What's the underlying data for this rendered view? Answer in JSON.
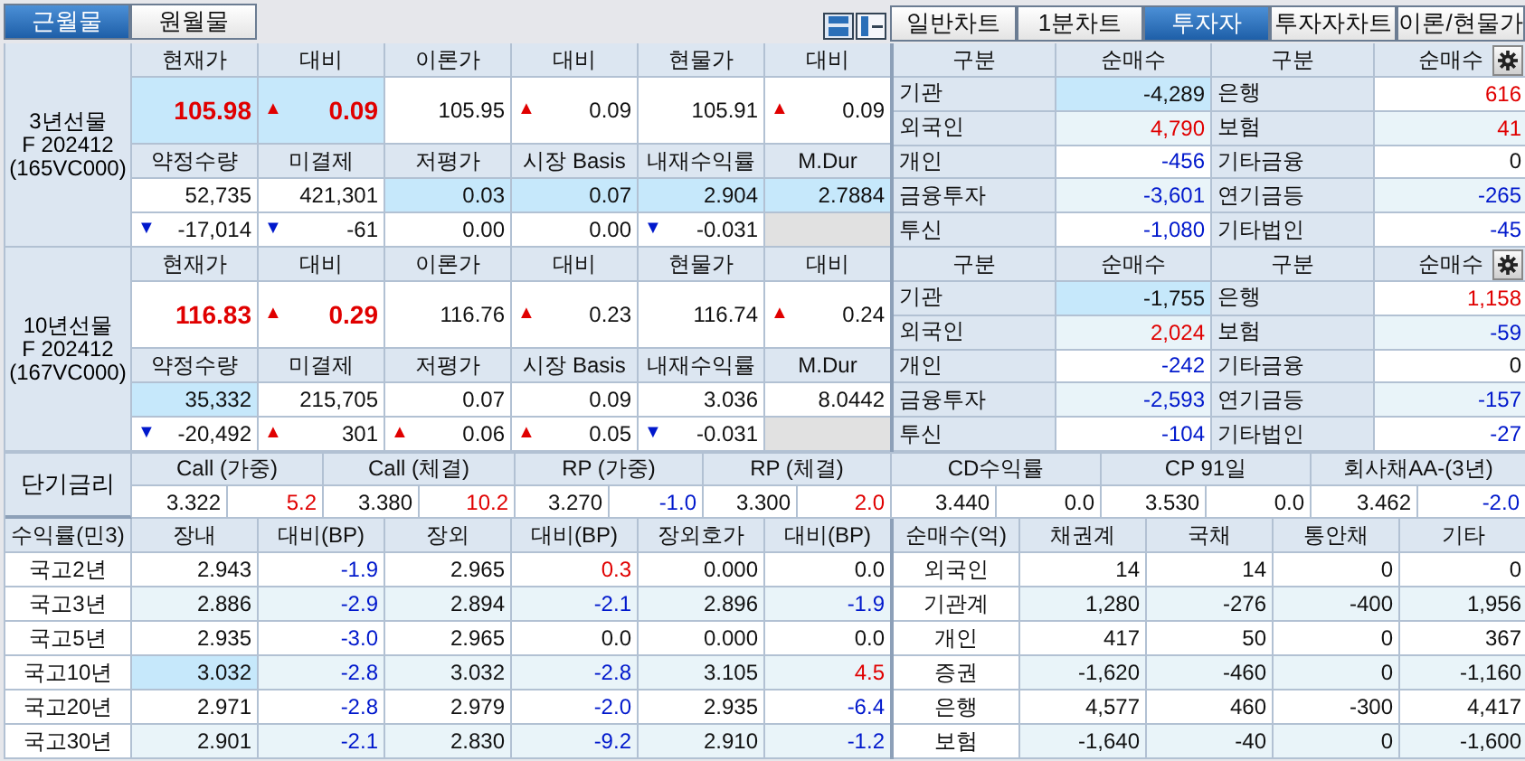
{
  "contract_tabs": [
    {
      "label": "근월물",
      "selected": true
    },
    {
      "label": "원월물",
      "selected": false
    }
  ],
  "view_tabs": [
    {
      "label": "일반차트",
      "selected": false
    },
    {
      "label": "1분차트",
      "selected": false
    },
    {
      "label": "투자자",
      "selected": true
    },
    {
      "label": "투자자차트",
      "selected": false
    },
    {
      "label": "이론/현물가",
      "selected": false
    }
  ],
  "futures": [
    {
      "label": [
        "3년선물",
        "F 202412",
        "(165VC000)"
      ],
      "header1": [
        "현재가",
        "대비",
        "이론가",
        "대비",
        "현물가",
        "대비"
      ],
      "row1": [
        {
          "text": "105.98",
          "color": "#e00000",
          "highlighted": true
        },
        {
          "text": "0.09",
          "arrow": {
            "symbol": "▲",
            "color": "#e00000"
          },
          "color": "#e00000",
          "highlighted": true
        },
        {
          "text": "105.95"
        },
        {
          "text": "0.09",
          "arrow": {
            "symbol": "▲",
            "color": "#e00000"
          }
        },
        {
          "text": "105.91"
        },
        {
          "text": "0.09",
          "arrow": {
            "symbol": "▲",
            "color": "#e00000"
          }
        }
      ],
      "header2": [
        "약정수량",
        "미결제",
        "저평가",
        "시장 Basis",
        "내재수익률",
        "M.Dur"
      ],
      "row2": [
        {
          "text": "52,735"
        },
        {
          "text": "421,301"
        },
        {
          "text": "0.03",
          "highlighted": true
        },
        {
          "text": "0.07",
          "highlighted": true
        },
        {
          "text": "2.904",
          "highlighted": true
        },
        {
          "text": "2.7884",
          "highlighted": true
        }
      ],
      "row3": [
        {
          "text": "-17,014",
          "arrow": {
            "symbol": "▼",
            "color": "#0018cc"
          }
        },
        {
          "text": "-61",
          "arrow": {
            "symbol": "▼",
            "color": "#0018cc"
          }
        },
        {
          "text": "0.00"
        },
        {
          "text": "0.00"
        },
        {
          "text": "-0.031",
          "arrow": {
            "symbol": "▼",
            "color": "#0018cc"
          }
        }
      ],
      "investors": {
        "header": [
          "구분",
          "순매수",
          "구분",
          "순매수"
        ],
        "rows": [
          {
            "left": "기관",
            "left_value": {
              "text": "-4,289",
              "highlighted": true
            },
            "right": "은행",
            "right_value": {
              "text": "616",
              "color": "#e00000"
            }
          },
          {
            "left": "외국인",
            "left_value": {
              "text": "4,790",
              "color": "#e00000"
            },
            "right": "보험",
            "right_value": {
              "text": "41",
              "color": "#e00000"
            }
          },
          {
            "left": "개인",
            "left_value": {
              "text": "-456",
              "color": "#0018cc"
            },
            "right": "기타금융",
            "right_value": {
              "text": "0"
            }
          },
          {
            "left": "금융투자",
            "left_value": {
              "text": "-3,601",
              "color": "#0018cc"
            },
            "right": "연기금등",
            "right_value": {
              "text": "-265",
              "color": "#0018cc"
            }
          },
          {
            "left": "투신",
            "left_value": {
              "text": "-1,080",
              "color": "#0018cc"
            },
            "right": "기타법인",
            "right_value": {
              "text": "-45",
              "color": "#0018cc"
            }
          }
        ]
      }
    },
    {
      "label": [
        "10년선물",
        "F 202412",
        "(167VC000)"
      ],
      "header1": [
        "현재가",
        "대비",
        "이론가",
        "대비",
        "현물가",
        "대비"
      ],
      "row1": [
        {
          "text": "116.83",
          "color": "#e00000"
        },
        {
          "text": "0.29",
          "arrow": {
            "symbol": "▲",
            "color": "#e00000"
          },
          "color": "#e00000"
        },
        {
          "text": "116.76"
        },
        {
          "text": "0.23",
          "arrow": {
            "symbol": "▲",
            "color": "#e00000"
          }
        },
        {
          "text": "116.74"
        },
        {
          "text": "0.24",
          "arrow": {
            "symbol": "▲",
            "color": "#e00000"
          }
        }
      ],
      "header2": [
        "약정수량",
        "미결제",
        "저평가",
        "시장 Basis",
        "내재수익률",
        "M.Dur"
      ],
      "row2": [
        {
          "text": "35,332",
          "highlighted": true
        },
        {
          "text": "215,705"
        },
        {
          "text": "0.07"
        },
        {
          "text": "0.09"
        },
        {
          "text": "3.036"
        },
        {
          "text": "8.0442"
        }
      ],
      "row3": [
        {
          "text": "-20,492",
          "arrow": {
            "symbol": "▼",
            "color": "#0018cc"
          }
        },
        {
          "text": "301",
          "arrow": {
            "symbol": "▲",
            "color": "#e00000"
          }
        },
        {
          "text": "0.06",
          "arrow": {
            "symbol": "▲",
            "color": "#e00000"
          }
        },
        {
          "text": "0.05",
          "arrow": {
            "symbol": "▲",
            "color": "#e00000"
          }
        },
        {
          "text": "-0.031",
          "arrow": {
            "symbol": "▼",
            "color": "#0018cc"
          }
        }
      ],
      "investors": {
        "header": [
          "구분",
          "순매수",
          "구분",
          "순매수"
        ],
        "rows": [
          {
            "left": "기관",
            "left_value": {
              "text": "-1,755",
              "highlighted": true
            },
            "right": "은행",
            "right_value": {
              "text": "1,158",
              "color": "#e00000"
            }
          },
          {
            "left": "외국인",
            "left_value": {
              "text": "2,024",
              "color": "#e00000"
            },
            "right": "보험",
            "right_value": {
              "text": "-59",
              "color": "#0018cc"
            }
          },
          {
            "left": "개인",
            "left_value": {
              "text": "-242",
              "color": "#0018cc"
            },
            "right": "기타금융",
            "right_value": {
              "text": "0"
            }
          },
          {
            "left": "금융투자",
            "left_value": {
              "text": "-2,593",
              "color": "#0018cc"
            },
            "right": "연기금등",
            "right_value": {
              "text": "-157",
              "color": "#0018cc"
            }
          },
          {
            "left": "투신",
            "left_value": {
              "text": "-104",
              "color": "#0018cc"
            },
            "right": "기타법인",
            "right_value": {
              "text": "-27",
              "color": "#0018cc"
            }
          }
        ]
      }
    }
  ],
  "short_rates": {
    "label": "단기금리",
    "groups": [
      {
        "title": "Call (가중)",
        "rate": "3.322",
        "change": {
          "text": "5.2",
          "color": "#e00000"
        }
      },
      {
        "title": "Call (체결)",
        "rate": "3.380",
        "change": {
          "text": "10.2",
          "color": "#e00000"
        }
      },
      {
        "title": "RP (가중)",
        "rate": "3.270",
        "change": {
          "text": "-1.0",
          "color": "#0018cc"
        }
      },
      {
        "title": "RP (체결)",
        "rate": "3.300",
        "change": {
          "text": "2.0",
          "color": "#e00000"
        }
      },
      {
        "title": "CD수익률",
        "rate": "3.440",
        "change": {
          "text": "0.0"
        }
      },
      {
        "title": "CP 91일",
        "rate": "3.530",
        "change": {
          "text": "0.0"
        }
      },
      {
        "title": "회사채AA-(3년)",
        "rate": "3.462",
        "change": {
          "text": "-2.0",
          "color": "#0018cc"
        }
      }
    ]
  },
  "yields": {
    "columns": [
      "수익률(민3)",
      "장내",
      "대비(BP)",
      "장외",
      "대비(BP)",
      "장외호가",
      "대비(BP)"
    ],
    "rows": [
      [
        {
          "text": "국고2년"
        },
        {
          "text": "2.943"
        },
        {
          "text": "-1.9",
          "color": "#0018cc"
        },
        {
          "text": "2.965"
        },
        {
          "text": "0.3",
          "color": "#e00000"
        },
        {
          "text": "0.000"
        },
        {
          "text": "0.0"
        }
      ],
      [
        {
          "text": "국고3년"
        },
        {
          "text": "2.886"
        },
        {
          "text": "-2.9",
          "color": "#0018cc"
        },
        {
          "text": "2.894"
        },
        {
          "text": "-2.1",
          "color": "#0018cc"
        },
        {
          "text": "2.896"
        },
        {
          "text": "-1.9",
          "color": "#0018cc"
        }
      ],
      [
        {
          "text": "국고5년"
        },
        {
          "text": "2.935"
        },
        {
          "text": "-3.0",
          "color": "#0018cc"
        },
        {
          "text": "2.965"
        },
        {
          "text": "0.0"
        },
        {
          "text": "0.000"
        },
        {
          "text": "0.0"
        }
      ],
      [
        {
          "text": "국고10년"
        },
        {
          "text": "3.032",
          "highlighted": true
        },
        {
          "text": "-2.8",
          "color": "#0018cc"
        },
        {
          "text": "3.032"
        },
        {
          "text": "-2.8",
          "color": "#0018cc"
        },
        {
          "text": "3.105"
        },
        {
          "text": "4.5",
          "color": "#e00000"
        }
      ],
      [
        {
          "text": "국고20년"
        },
        {
          "text": "2.971"
        },
        {
          "text": "-2.8",
          "color": "#0018cc"
        },
        {
          "text": "2.979"
        },
        {
          "text": "-2.0",
          "color": "#0018cc"
        },
        {
          "text": "2.935"
        },
        {
          "text": "-6.4",
          "color": "#0018cc"
        }
      ],
      [
        {
          "text": "국고30년"
        },
        {
          "text": "2.901"
        },
        {
          "text": "-2.1",
          "color": "#0018cc"
        },
        {
          "text": "2.830"
        },
        {
          "text": "-9.2",
          "color": "#0018cc"
        },
        {
          "text": "2.910"
        },
        {
          "text": "-1.2",
          "color": "#0018cc"
        }
      ]
    ]
  },
  "net_buying": {
    "columns": [
      "순매수(억)",
      "채권계",
      "국채",
      "통안채",
      "기타"
    ],
    "rows": [
      [
        "외국인",
        "14",
        "14",
        "0",
        "0"
      ],
      [
        "기관계",
        "1,280",
        "-276",
        "-400",
        "1,956"
      ],
      [
        "개인",
        "417",
        "50",
        "0",
        "367"
      ],
      [
        "증권",
        "-1,620",
        "-460",
        "0",
        "-1,160"
      ],
      [
        "은행",
        "4,577",
        "460",
        "-300",
        "4,417"
      ],
      [
        "보험",
        "-1,640",
        "-40",
        "0",
        "-1,600"
      ]
    ]
  }
}
